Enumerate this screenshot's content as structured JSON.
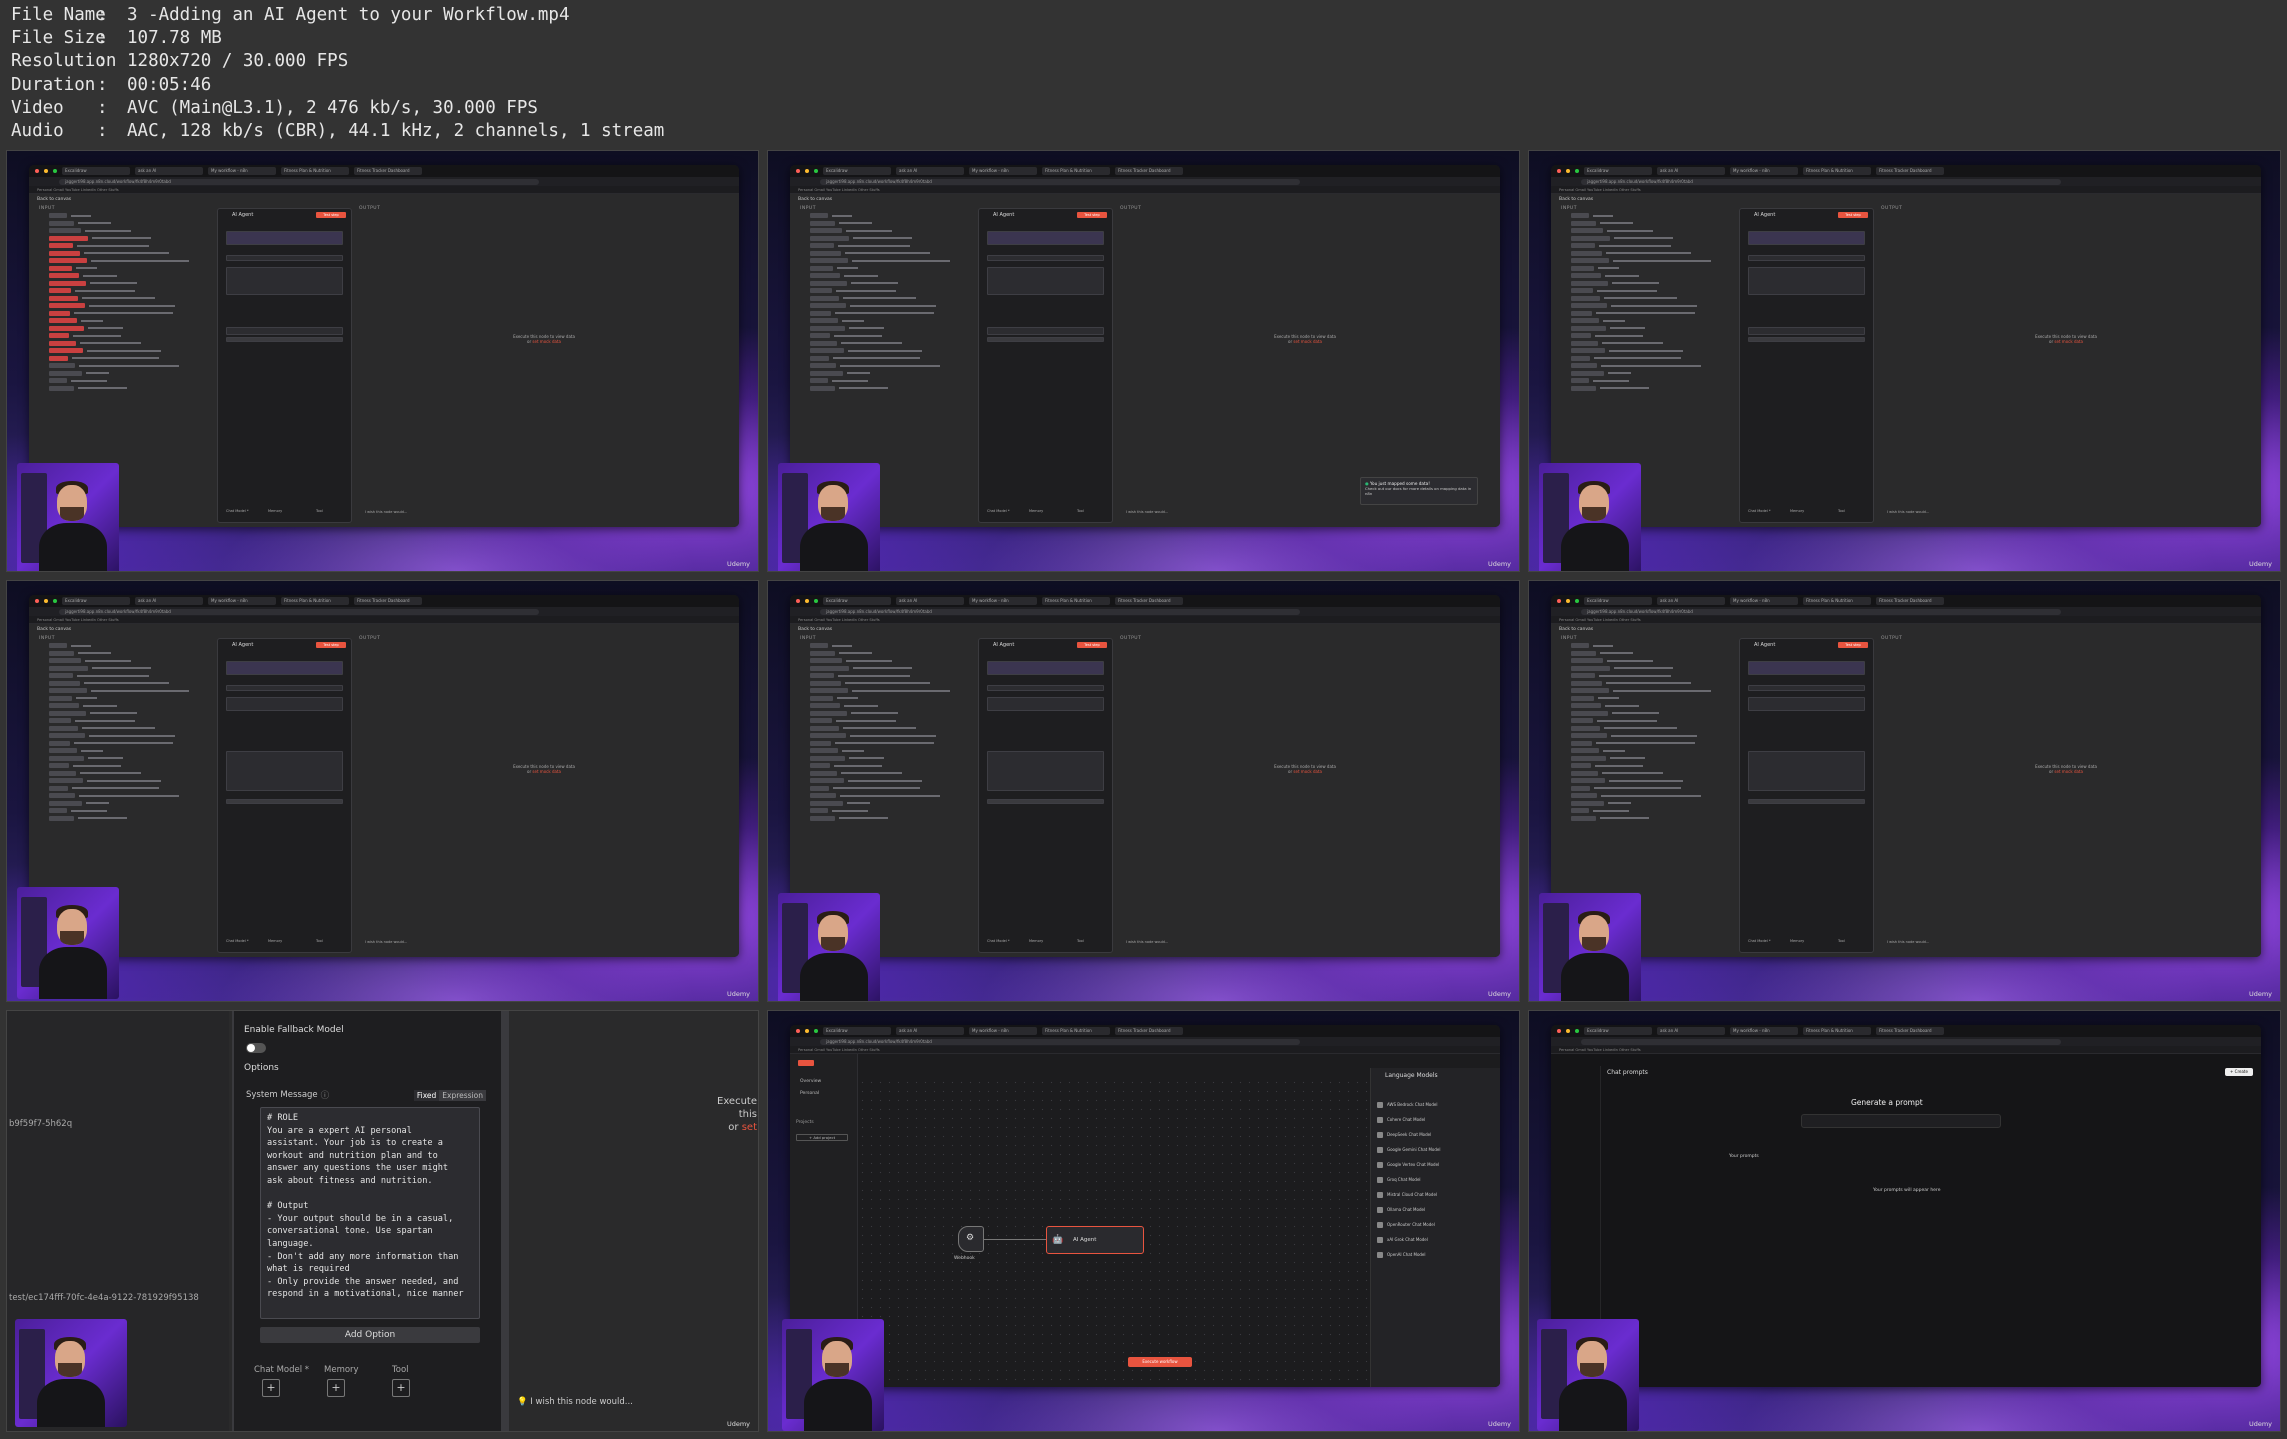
{
  "header": {
    "rows": [
      {
        "key": "File Name",
        "sep": ":",
        "value": "3 -Adding an AI Agent to your Workflow.mp4"
      },
      {
        "key": "File Size",
        "sep": ":",
        "value": "107.78 MB"
      },
      {
        "key": "Resolution",
        "sep": ":",
        "value": "1280x720 / 30.000 FPS"
      },
      {
        "key": "Duration",
        "sep": ":",
        "value": "00:05:46"
      },
      {
        "key": "Video",
        "sep": ":",
        "value": "AVC (Main@L3.1), 2 476 kb/s, 30.000 FPS"
      },
      {
        "key": "Audio",
        "sep": ":",
        "value": "AAC, 128 kb/s (CBR), 44.1 kHz, 2 channels, 1 stream"
      }
    ]
  },
  "colors": {
    "background": "#333333",
    "accent": "#e8543f",
    "panel": "#1e1e20",
    "purple": "#6a2cd0"
  },
  "watermark": "Udemy",
  "editor": {
    "back": "Back to canvas",
    "input": "INPUT",
    "output": "OUTPUT",
    "node_title": "AI Agent",
    "test_step": "Test step",
    "execute_1": "Execute this node to view data",
    "execute_2_prefix": "or",
    "execute_2_link": "set mock data",
    "chat_model": "Chat Model *",
    "memory": "Memory",
    "tool": "Tool",
    "wish": "I wish this node would..."
  },
  "toast": {
    "title": "You just mapped some data!",
    "body": "Check out our docs for more details on mapping data in n8n"
  },
  "zoom": {
    "enable_fallback": "Enable Fallback Model",
    "options": "Options",
    "system_message": "System Message",
    "fixed": "Fixed",
    "expression": "Expression",
    "system_text": "# ROLE\nYou are a expert AI personal\nassistant. Your job is to create a\nworkout and nutrition plan and to\nanswer any questions the user might\nask about fitness and nutrition.\n\n# Output\n- Your output should be in a casual,\nconversational tone. Use spartan\nlanguage.\n- Don't add any more information than\nwhat is required\n- Only provide the answer needed, and\nrespond in a motivational, nice manner",
    "add_option": "Add Option",
    "chat_model": "Chat Model *",
    "memory": "Memory",
    "tool": "Tool",
    "wish": "I wish this node would...",
    "left_id_1": "b9f59f7-5h62q",
    "left_id_2": "test/ec174fff-70fc-4e4a-9122-781929f95138",
    "execute_1": "Execute this",
    "execute_2_prefix": "or",
    "execute_2_link": "set"
  },
  "canvas": {
    "panel_title": "Language Models",
    "models": [
      "AWS Bedrock Chat Model",
      "Cohere Chat Model",
      "DeepSeek Chat Model",
      "Google Gemini Chat Model",
      "Google Vertex Chat Model",
      "Groq Chat Model",
      "Mistral Cloud Chat Model",
      "Ollama Chat Model",
      "OpenRouter Chat Model",
      "xAI Grok Chat Model",
      "OpenAI Chat Model"
    ],
    "webhook": "Webhook",
    "agent": "AI Agent",
    "execute": "Execute workflow",
    "overview": "Overview",
    "personal": "Personal",
    "projects": "Projects",
    "add_project": "+ Add project"
  },
  "chat": {
    "title": "Chat prompts",
    "generate": "Generate a prompt",
    "your_prompts": "Your prompts",
    "empty": "Your prompts will appear here",
    "create": "+ Create"
  },
  "browser": {
    "url": "jaggerti98.app.n8n.cloud/workflow/fk4f8h4m9r0tabd",
    "bookmarks": "Personal   Gmail   YouTube   LinkedIn   Other Stuffs",
    "tabs": [
      "Excalidraw",
      "ask an AI",
      "My workflow - n8n",
      "Fitness Plan & Nutrition",
      "Fitness Tracker Dashboard"
    ]
  }
}
